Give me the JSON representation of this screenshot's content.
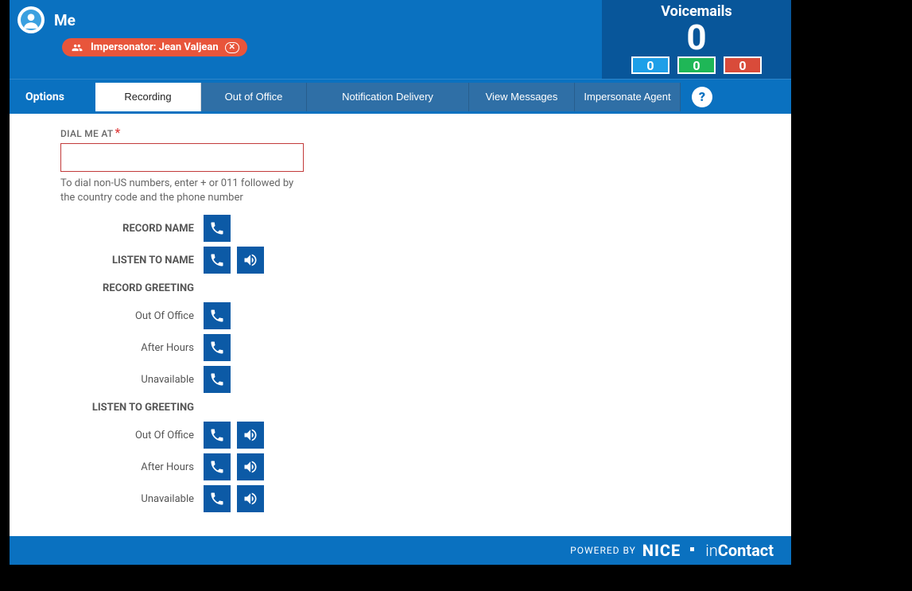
{
  "header": {
    "username": "Me",
    "impersonator_label": "Impersonator: Jean Valjean"
  },
  "voicemail": {
    "title": "Voicemails",
    "count": "0",
    "badges": {
      "blue": "0",
      "green": "0",
      "red": "0"
    }
  },
  "tabs": {
    "options_label": "Options",
    "items": [
      {
        "label": "Recording",
        "active": true
      },
      {
        "label": "Out of Office"
      },
      {
        "label": "Notification Delivery"
      },
      {
        "label": "View Messages"
      },
      {
        "label": "Impersonate Agent"
      }
    ],
    "help": "?"
  },
  "form": {
    "dial_label": "DIAL ME AT",
    "dial_value": "",
    "hint": "To dial non-US numbers, enter + or 011 followed by the country code and the phone number",
    "record_name_label": "RECORD NAME",
    "listen_name_label": "LISTEN TO NAME",
    "record_greeting_label": "RECORD GREETING",
    "listen_greeting_label": "LISTEN TO GREETING",
    "greetings": {
      "out_of_office": "Out Of Office",
      "after_hours": "After Hours",
      "unavailable": "Unavailable"
    }
  },
  "footer": {
    "powered": "POWERED BY",
    "brand1": "NICE",
    "brand2a": "in",
    "brand2b": "Contact"
  }
}
